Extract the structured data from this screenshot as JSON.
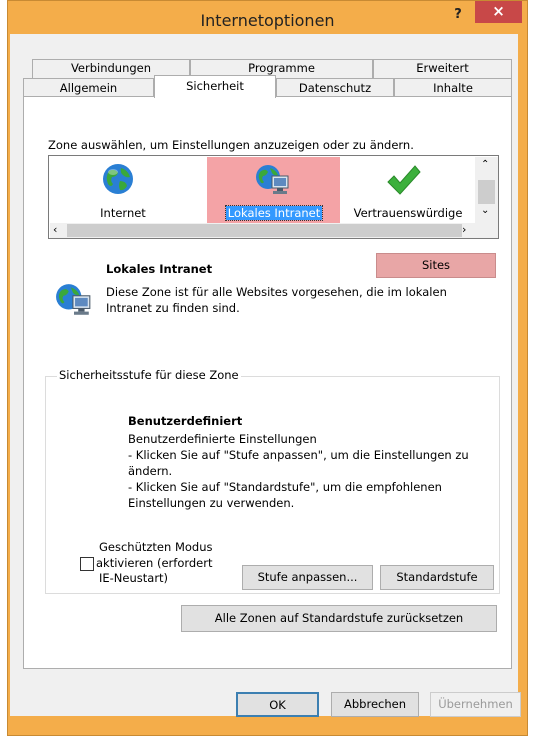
{
  "window": {
    "title": "Internetoptionen",
    "help": "?",
    "close": "×"
  },
  "tabs": {
    "row_back": [
      "Verbindungen",
      "Programme",
      "Erweitert"
    ],
    "row_front": [
      "Allgemein",
      "Sicherheit",
      "Datenschutz",
      "Inhalte"
    ],
    "selected": "Sicherheit"
  },
  "zones": {
    "prompt": "Zone auswählen, um Einstellungen anzuzeigen oder zu ändern.",
    "items": [
      {
        "label": "Internet",
        "icon": "globe-icon"
      },
      {
        "label": "Lokales Intranet",
        "icon": "intranet-icon"
      },
      {
        "label": "Vertrauenswürdige",
        "icon": "checkmark-icon"
      }
    ],
    "selected": "Lokales Intranet"
  },
  "zone_info": {
    "title": "Lokales Intranet",
    "description_line1": "Diese Zone ist für alle Websites vorgesehen, die im lokalen",
    "description_line2": "Intranet zu finden sind.",
    "sites_button": "Sites"
  },
  "security_level": {
    "group_label": "Sicherheitsstufe für diese Zone",
    "level_title": "Benutzerdefiniert",
    "lines": [
      "Benutzerdefinierte Einstellungen",
      "- Klicken Sie auf \"Stufe anpassen\", um die Einstellungen zu",
      "ändern.",
      "- Klicken Sie auf \"Standardstufe\", um die empfohlenen",
      "Einstellungen zu verwenden."
    ]
  },
  "protected_mode": {
    "line1": "Geschützten Modus",
    "line2": "aktivieren (erfordert",
    "line3": "IE-Neustart)",
    "checked": false
  },
  "buttons": {
    "custom_level": "Stufe anpassen...",
    "default_level": "Standardstufe",
    "reset_all": "Alle Zonen auf Standardstufe zurücksetzen",
    "ok": "OK",
    "cancel": "Abbrechen",
    "apply": "Übernehmen"
  },
  "colors": {
    "frame": "#f4ad4a",
    "close_button": "#c84848",
    "selection": "#f4a3a6",
    "selection_text_bg": "#3399ff"
  }
}
